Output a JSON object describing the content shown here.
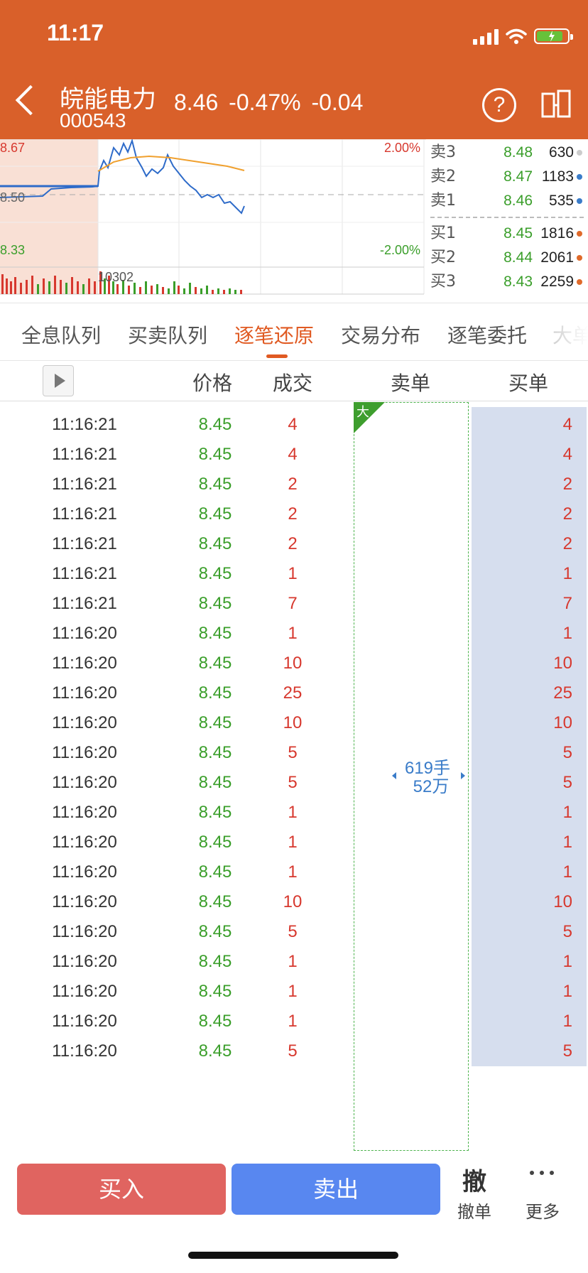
{
  "status_bar": {
    "time": "11:17"
  },
  "header": {
    "stock_name": "皖能电力",
    "stock_code": "000543",
    "price": "8.46",
    "change_pct": "-0.47%",
    "change": "-0.04"
  },
  "mini_chart": {
    "high_label": "8.67",
    "mid_label": "8.50",
    "low_label": "8.33",
    "up_pct_label": "2.00%",
    "down_pct_label": "-2.00%",
    "volume_label": "10302"
  },
  "orderbook": {
    "asks": [
      {
        "label": "卖3",
        "price": "8.48",
        "volume": "630",
        "dot": "#cccccc"
      },
      {
        "label": "卖2",
        "price": "8.47",
        "volume": "1183",
        "dot": "#3A7CC9"
      },
      {
        "label": "卖1",
        "price": "8.46",
        "volume": "535",
        "dot": "#3A7CC9"
      }
    ],
    "bids": [
      {
        "label": "买1",
        "price": "8.45",
        "volume": "1816",
        "dot": "#E06A2A"
      },
      {
        "label": "买2",
        "price": "8.44",
        "volume": "2061",
        "dot": "#E06A2A"
      },
      {
        "label": "买3",
        "price": "8.43",
        "volume": "2259",
        "dot": "#E06A2A"
      }
    ]
  },
  "tabs": [
    {
      "label": "全息队列"
    },
    {
      "label": "买卖队列"
    },
    {
      "label": "逐笔还原"
    },
    {
      "label": "交易分布"
    },
    {
      "label": "逐笔委托"
    },
    {
      "label": "大单"
    }
  ],
  "active_tab": "逐笔还原",
  "table": {
    "headers": {
      "price": "价格",
      "volume": "成交",
      "sell": "卖单",
      "buy": "买单"
    },
    "rows": [
      {
        "time": "11:16:21",
        "price": "8.45",
        "volume": "4",
        "buy": "4"
      },
      {
        "time": "11:16:21",
        "price": "8.45",
        "volume": "4",
        "buy": "4"
      },
      {
        "time": "11:16:21",
        "price": "8.45",
        "volume": "2",
        "buy": "2"
      },
      {
        "time": "11:16:21",
        "price": "8.45",
        "volume": "2",
        "buy": "2"
      },
      {
        "time": "11:16:21",
        "price": "8.45",
        "volume": "2",
        "buy": "2"
      },
      {
        "time": "11:16:21",
        "price": "8.45",
        "volume": "1",
        "buy": "1"
      },
      {
        "time": "11:16:21",
        "price": "8.45",
        "volume": "7",
        "buy": "7"
      },
      {
        "time": "11:16:20",
        "price": "8.45",
        "volume": "1",
        "buy": "1"
      },
      {
        "time": "11:16:20",
        "price": "8.45",
        "volume": "10",
        "buy": "10"
      },
      {
        "time": "11:16:20",
        "price": "8.45",
        "volume": "25",
        "buy": "25"
      },
      {
        "time": "11:16:20",
        "price": "8.45",
        "volume": "10",
        "buy": "10"
      },
      {
        "time": "11:16:20",
        "price": "8.45",
        "volume": "5",
        "buy": "5"
      },
      {
        "time": "11:16:20",
        "price": "8.45",
        "volume": "5",
        "buy": "5"
      },
      {
        "time": "11:16:20",
        "price": "8.45",
        "volume": "1",
        "buy": "1"
      },
      {
        "time": "11:16:20",
        "price": "8.45",
        "volume": "1",
        "buy": "1"
      },
      {
        "time": "11:16:20",
        "price": "8.45",
        "volume": "1",
        "buy": "1"
      },
      {
        "time": "11:16:20",
        "price": "8.45",
        "volume": "10",
        "buy": "10"
      },
      {
        "time": "11:16:20",
        "price": "8.45",
        "volume": "5",
        "buy": "5"
      },
      {
        "time": "11:16:20",
        "price": "8.45",
        "volume": "1",
        "buy": "1"
      },
      {
        "time": "11:16:20",
        "price": "8.45",
        "volume": "1",
        "buy": "1"
      },
      {
        "time": "11:16:20",
        "price": "8.45",
        "volume": "1",
        "buy": "1"
      },
      {
        "time": "11:16:20",
        "price": "8.45",
        "volume": "5",
        "buy": "5"
      }
    ]
  },
  "sell_order": {
    "tag": "大",
    "lots": "619手",
    "amount": "52万"
  },
  "bottom": {
    "buy_label": "买入",
    "sell_label": "卖出",
    "cancel_icon_char": "撤",
    "cancel_label": "撤单",
    "more_label": "更多"
  },
  "colors": {
    "header_bg": "#D9602A",
    "up": "#D7382E",
    "down": "#3A9E2A",
    "active_tab": "#E05A22"
  }
}
